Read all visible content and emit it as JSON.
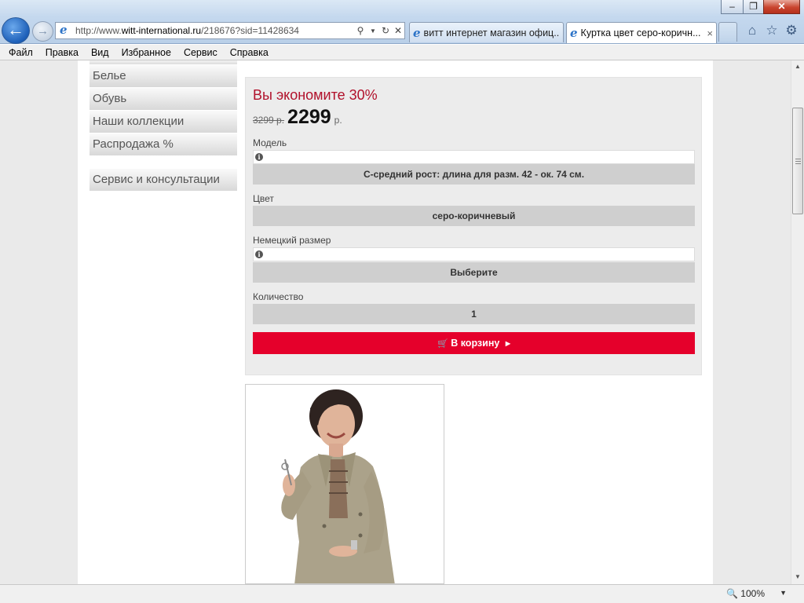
{
  "browser": {
    "address": {
      "prefix": "http://www.",
      "domain": "witt-international.ru",
      "path": "/218676?sid=11428634"
    },
    "tabs": [
      {
        "label": "витт интернет магазин офиц..."
      },
      {
        "label": "Куртка цвет серо-коричн...",
        "close": "×"
      }
    ],
    "window_buttons": {
      "minimize": "–",
      "restore": "❐",
      "close": "✕"
    },
    "icons": {
      "back": "back-arrow-icon",
      "forward": "forward-arrow-icon",
      "home": "home-icon",
      "favorites": "star-icon",
      "tools": "gear-icon"
    }
  },
  "menu": [
    "Файл",
    "Правка",
    "Вид",
    "Избранное",
    "Сервис",
    "Справка"
  ],
  "sidebar": {
    "items": [
      {
        "label": "Белье"
      },
      {
        "label": "Обувь"
      },
      {
        "label": "Наши коллекции"
      },
      {
        "label": "Распродажа %"
      }
    ],
    "service": "Сервис и консультации"
  },
  "product": {
    "savings": "Вы экономите 30%",
    "old_price": "3299 р.",
    "price": "2299",
    "currency": "р.",
    "model_label": "Модель",
    "model_value": "С-средний рост: длина для разм. 42 - ок. 74 см.",
    "color_label": "Цвет",
    "color_value": "серо-коричневый",
    "size_label": "Немецкий размер",
    "size_value": "Выберите",
    "quantity_label": "Количество",
    "quantity_value": "1",
    "cart_button": "В корзину",
    "accent_color": "#e5002b",
    "savings_color": "#b1112b"
  },
  "status": {
    "zoom": "100%"
  }
}
